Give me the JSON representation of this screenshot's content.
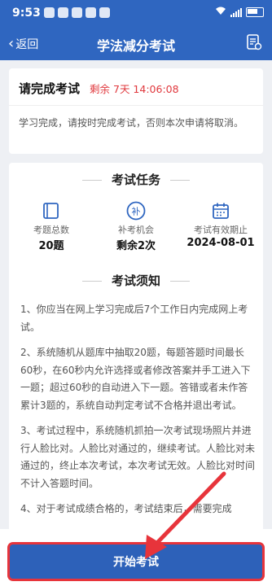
{
  "status_bar": {
    "time": "9:53",
    "right_text": "≋",
    "battery_hint": ""
  },
  "nav": {
    "back_label": "返回",
    "title": "学法减分考试",
    "action_icon": "document-icon"
  },
  "summary_card": {
    "title": "请完成考试",
    "remaining": "剩余 7天 14:06:08",
    "message": "学习完成，请按时完成考试，否则本次申请将取消。"
  },
  "task_section": {
    "heading": "考试任务",
    "items": [
      {
        "label": "考题总数",
        "value": "20题",
        "icon": "book-icon"
      },
      {
        "label": "补考机会",
        "value": "剩余2次",
        "icon": "retake-icon"
      },
      {
        "label": "考试有效期止",
        "value": "2024-08-01",
        "icon": "calendar-icon"
      }
    ]
  },
  "notice_section": {
    "heading": "考试须知",
    "items": [
      "1、你应当在网上学习完成后7个工作日内完成网上考试。",
      "2、系统随机从题库中抽取20题，每题答题时间最长60秒，在60秒内允许选择或者修改答案并手工进入下一题；超过60秒的自动进入下一题。答错或者未作答累计3题的，系统自动判定考试不合格并退出考试。",
      "3、考试过程中，系统随机抓拍一次考试现场照片并进行人脸比对。人脸比对通过的，继续考试。人脸比对未通过的，终止本次考试，本次考试无效。人脸比对时间不计入答题时间。",
      "4、对于考试成绩合格的，考试结束后，需要完成"
    ]
  },
  "bottom": {
    "start_button": "开始考试"
  },
  "colors": {
    "brand_blue": "#2f66c0",
    "remaining_red": "#e0393e",
    "annotation_red": "#e7343b"
  }
}
